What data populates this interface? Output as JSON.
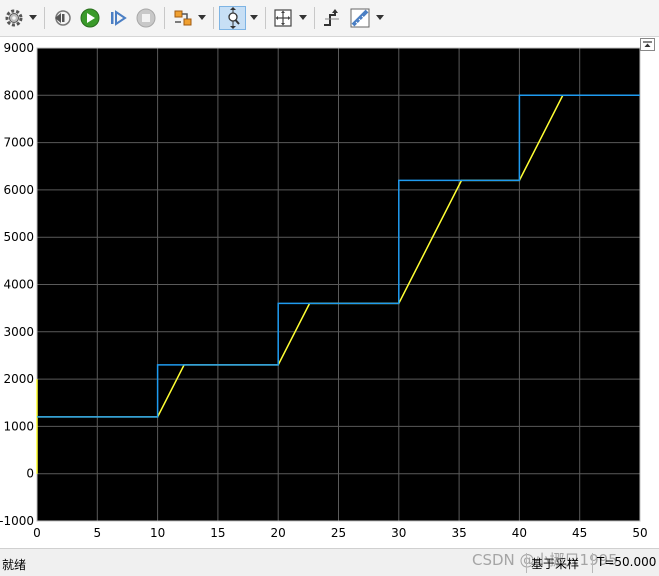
{
  "toolbar": {
    "buttons": [
      {
        "name": "settings",
        "icon": "gear-icon",
        "caret": true
      },
      {
        "name": "step-back",
        "icon": "step-back-icon",
        "caret": false
      },
      {
        "name": "run",
        "icon": "run-icon",
        "caret": false
      },
      {
        "name": "step-forward",
        "icon": "step-forward-icon",
        "caret": false
      },
      {
        "name": "stop",
        "icon": "stop-icon",
        "caret": false
      },
      {
        "name": "highlight",
        "icon": "highlight-block-icon",
        "caret": true
      },
      {
        "name": "zoom",
        "icon": "zoom-icon",
        "caret": true,
        "active": true
      },
      {
        "name": "autoscale",
        "icon": "autoscale-icon",
        "caret": true
      },
      {
        "name": "triggers",
        "icon": "triggers-icon",
        "caret": false
      },
      {
        "name": "measurements",
        "icon": "ruler-icon",
        "caret": true
      }
    ]
  },
  "colors": {
    "plot_background": "#000000",
    "grid": "#5a5a5a",
    "axis_border": "#c0c0c0",
    "series1": "#ffff33",
    "series2": "#1f9bf0"
  },
  "chart_data": {
    "type": "line",
    "title": "",
    "xlabel": "",
    "ylabel": "",
    "xlim": [
      0,
      50
    ],
    "ylim": [
      -1000,
      9000
    ],
    "xticks": [
      0,
      5,
      10,
      15,
      20,
      25,
      30,
      35,
      40,
      45,
      50
    ],
    "yticks": [
      -1000,
      0,
      1000,
      2000,
      3000,
      4000,
      5000,
      6000,
      7000,
      8000,
      9000
    ],
    "grid": true,
    "legend": "none",
    "series": [
      {
        "color": "#ffff33",
        "x": [
          0,
          0,
          0,
          10,
          12.2,
          20,
          22.6,
          30,
          35.2,
          40,
          43.6,
          50
        ],
        "y": [
          0,
          2000,
          1200,
          1200,
          2300,
          2300,
          3600,
          3600,
          6200,
          6200,
          8000,
          8000
        ]
      },
      {
        "color": "#1f9bf0",
        "x": [
          0,
          10,
          10,
          20,
          20,
          30,
          30,
          40,
          40,
          50
        ],
        "y": [
          1200,
          1200,
          2300,
          2300,
          3600,
          3600,
          6200,
          6200,
          8000,
          8000
        ]
      }
    ]
  },
  "status": {
    "left_text": "就绪",
    "mode_text": "基于采样",
    "time_text": "T=50.000"
  },
  "watermark": "CSDN @小挪只1995"
}
